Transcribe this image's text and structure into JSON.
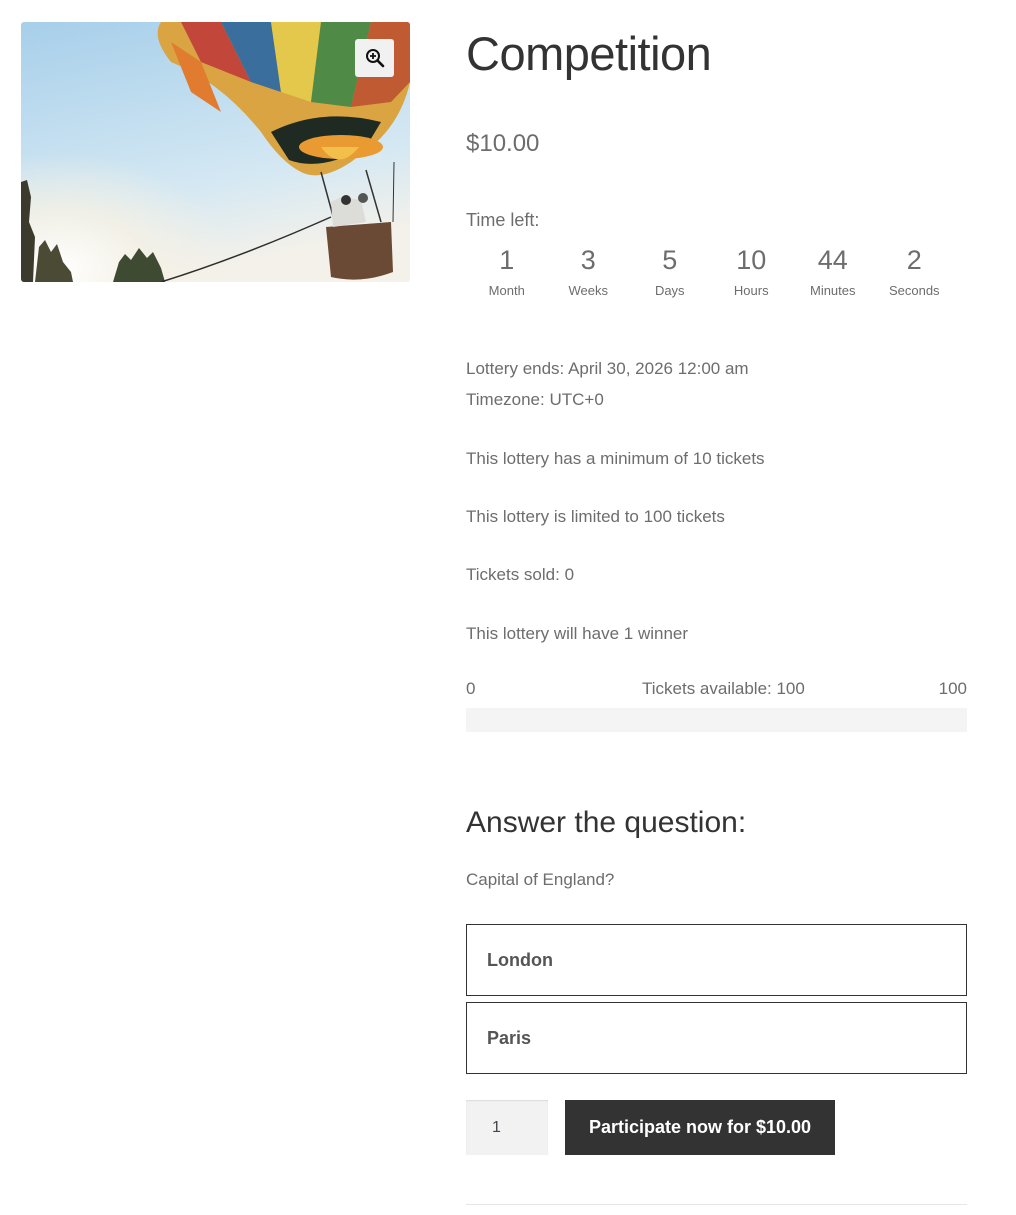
{
  "product": {
    "title": "Competition",
    "price": "$10.00",
    "image_alt": "hot-air-balloon",
    "zoom_icon": "magnifier-plus-icon"
  },
  "countdown": {
    "label": "Time left:",
    "units": [
      {
        "value": "1",
        "label": "Month"
      },
      {
        "value": "3",
        "label": "Weeks"
      },
      {
        "value": "5",
        "label": "Days"
      },
      {
        "value": "10",
        "label": "Hours"
      },
      {
        "value": "44",
        "label": "Minutes"
      },
      {
        "value": "2",
        "label": "Seconds"
      }
    ]
  },
  "lottery": {
    "ends": "Lottery ends: April 30, 2026 12:00 am",
    "timezone": "Timezone: UTC+0",
    "min_tickets": "This lottery has a minimum of 10 tickets",
    "max_tickets": "This lottery is limited to 100 tickets",
    "sold": "Tickets sold: 0",
    "winners": "This lottery will have 1 winner"
  },
  "progress": {
    "min_label": "0",
    "available_label": "Tickets available: 100",
    "max_label": "100",
    "fraction_sold": 0
  },
  "question": {
    "heading": "Answer the question:",
    "text": "Capital of England?",
    "answers": [
      "London",
      "Paris"
    ]
  },
  "purchase": {
    "quantity": "1",
    "button_label": "Participate now for $10.00"
  },
  "colors": {
    "button_bg": "#333333",
    "text": "#6d6d6d",
    "heading": "#333333"
  }
}
